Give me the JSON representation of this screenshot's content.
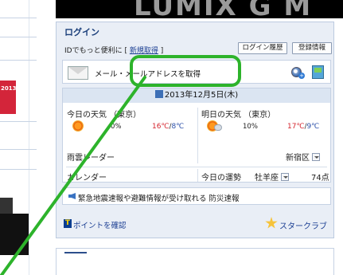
{
  "left_thumb_text": "2013",
  "banner": {
    "text": "LUMIX G M"
  },
  "login": {
    "title": "ログイン",
    "id_prefix": "IDでもっと便利に [ ",
    "signup_link": "新規取得",
    "id_suffix": " ]",
    "history_button": "ログイン履歴",
    "register_button": "登録情報"
  },
  "mail": {
    "text": "メール・メールアドレスを取得"
  },
  "weather": {
    "date": "2013年12月5日(木)",
    "today": {
      "title": "今日の天気 （東京）",
      "rain": "0%",
      "high": "16℃",
      "low": "8℃",
      "icon": "sun-icon"
    },
    "tomorrow": {
      "title": "明日の天気 （東京）",
      "rain": "10%",
      "high": "17℃",
      "low": "9℃",
      "icon": "sun-cloud-icon"
    },
    "separator": "/",
    "radar": "雨雲レーダー",
    "region": "新宿区",
    "calendar": "カレンダー",
    "fortune_label": "今日の運勢",
    "sign": "牡羊座",
    "score": "74点"
  },
  "alert": {
    "text": "緊急地震速報や避難情報が受け取れる 防災速報"
  },
  "footer": {
    "t_logo": "T",
    "points_link": "ポイントを確認",
    "star_link": "スタークラブ"
  },
  "colors": {
    "highlight": "#2db32b",
    "temp_high": "#d4252e",
    "temp_low": "#2a4fa8",
    "link": "#1c3f93"
  }
}
